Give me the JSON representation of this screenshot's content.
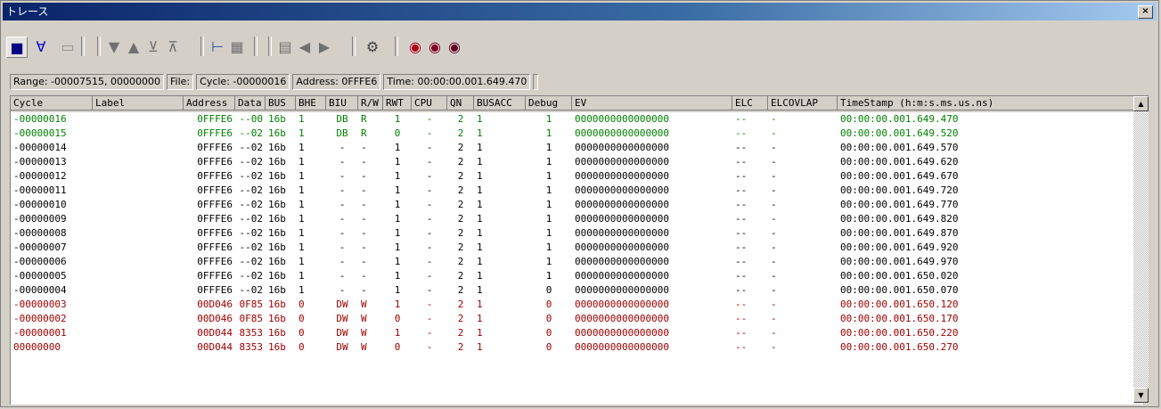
{
  "window": {
    "title": "トレース",
    "close_label": "×"
  },
  "toolbar": {
    "buttons": [
      {
        "name": "trace-on-icon",
        "glyph": "■",
        "color": "#000080"
      },
      {
        "name": "filter-icon",
        "glyph": "∀",
        "color": "#0000cc"
      },
      {
        "name": "copy-icon",
        "glyph": "▭",
        "color": "#909090"
      },
      {
        "name": "scroll-down-icon",
        "glyph": "▼",
        "color": "#707070"
      },
      {
        "name": "scroll-up-icon",
        "glyph": "▲",
        "color": "#707070"
      },
      {
        "name": "jump-end-icon",
        "glyph": "⊻",
        "color": "#707070"
      },
      {
        "name": "jump-start-icon",
        "glyph": "⊼",
        "color": "#707070"
      },
      {
        "name": "tree-icon",
        "glyph": "⊢",
        "color": "#3050a0"
      },
      {
        "name": "columns-icon",
        "glyph": "▦",
        "color": "#707070"
      },
      {
        "name": "list-icon",
        "glyph": "▤",
        "color": "#707070"
      },
      {
        "name": "prev-icon",
        "glyph": "◀",
        "color": "#707070"
      },
      {
        "name": "next-icon",
        "glyph": "▶",
        "color": "#707070"
      },
      {
        "name": "settings-icon",
        "glyph": "⚙",
        "color": "#404040"
      },
      {
        "name": "search-icon",
        "glyph": "◉",
        "color": "#b00020"
      },
      {
        "name": "search-prev-icon",
        "glyph": "◉",
        "color": "#800020"
      },
      {
        "name": "search-next-icon",
        "glyph": "◉",
        "color": "#600020"
      }
    ]
  },
  "status": {
    "range": "Range: -00007515,  00000000",
    "file": "File:",
    "cycle": "Cycle: -00000016",
    "address": "Address: 0FFFE6",
    "time": "Time: 00:00:00.001.649.470"
  },
  "columns": [
    "Cycle",
    "Label",
    "Address",
    "Data",
    "BUS",
    "BHE",
    "BIU",
    "R/W",
    "RWT",
    "CPU",
    "QN",
    "BUSACC",
    "Debug",
    "EV",
    "ELC",
    "ELCOVLAP",
    "TimeStamp (h:m:s.ms.us.ns)"
  ],
  "colors": {
    "green": "#008000",
    "black": "#000000",
    "red": "#a00000"
  },
  "rows": [
    {
      "color": "green",
      "cells": [
        "-00000016",
        "",
        "0FFFE6",
        "--00",
        "16b",
        "1",
        "DB",
        "R",
        "1",
        "-",
        "2",
        "1",
        "1",
        "0000000000000000",
        "--",
        "-",
        "00:00:00.001.649.470"
      ]
    },
    {
      "color": "green",
      "cells": [
        "-00000015",
        "",
        "0FFFE6",
        "--02",
        "16b",
        "1",
        "DB",
        "R",
        "0",
        "-",
        "2",
        "1",
        "1",
        "0000000000000000",
        "--",
        "-",
        "00:00:00.001.649.520"
      ]
    },
    {
      "color": "black",
      "cells": [
        "-00000014",
        "",
        "0FFFE6",
        "--02",
        "16b",
        "1",
        "-",
        "-",
        "1",
        "-",
        "2",
        "1",
        "1",
        "0000000000000000",
        "--",
        "-",
        "00:00:00.001.649.570"
      ]
    },
    {
      "color": "black",
      "cells": [
        "-00000013",
        "",
        "0FFFE6",
        "--02",
        "16b",
        "1",
        "-",
        "-",
        "1",
        "-",
        "2",
        "1",
        "1",
        "0000000000000000",
        "--",
        "-",
        "00:00:00.001.649.620"
      ]
    },
    {
      "color": "black",
      "cells": [
        "-00000012",
        "",
        "0FFFE6",
        "--02",
        "16b",
        "1",
        "-",
        "-",
        "1",
        "-",
        "2",
        "1",
        "1",
        "0000000000000000",
        "--",
        "-",
        "00:00:00.001.649.670"
      ]
    },
    {
      "color": "black",
      "cells": [
        "-00000011",
        "",
        "0FFFE6",
        "--02",
        "16b",
        "1",
        "-",
        "-",
        "1",
        "-",
        "2",
        "1",
        "1",
        "0000000000000000",
        "--",
        "-",
        "00:00:00.001.649.720"
      ]
    },
    {
      "color": "black",
      "cells": [
        "-00000010",
        "",
        "0FFFE6",
        "--02",
        "16b",
        "1",
        "-",
        "-",
        "1",
        "-",
        "2",
        "1",
        "1",
        "0000000000000000",
        "--",
        "-",
        "00:00:00.001.649.770"
      ]
    },
    {
      "color": "black",
      "cells": [
        "-00000009",
        "",
        "0FFFE6",
        "--02",
        "16b",
        "1",
        "-",
        "-",
        "1",
        "-",
        "2",
        "1",
        "1",
        "0000000000000000",
        "--",
        "-",
        "00:00:00.001.649.820"
      ]
    },
    {
      "color": "black",
      "cells": [
        "-00000008",
        "",
        "0FFFE6",
        "--02",
        "16b",
        "1",
        "-",
        "-",
        "1",
        "-",
        "2",
        "1",
        "1",
        "0000000000000000",
        "--",
        "-",
        "00:00:00.001.649.870"
      ]
    },
    {
      "color": "black",
      "cells": [
        "-00000007",
        "",
        "0FFFE6",
        "--02",
        "16b",
        "1",
        "-",
        "-",
        "1",
        "-",
        "2",
        "1",
        "1",
        "0000000000000000",
        "--",
        "-",
        "00:00:00.001.649.920"
      ]
    },
    {
      "color": "black",
      "cells": [
        "-00000006",
        "",
        "0FFFE6",
        "--02",
        "16b",
        "1",
        "-",
        "-",
        "1",
        "-",
        "2",
        "1",
        "1",
        "0000000000000000",
        "--",
        "-",
        "00:00:00.001.649.970"
      ]
    },
    {
      "color": "black",
      "cells": [
        "-00000005",
        "",
        "0FFFE6",
        "--02",
        "16b",
        "1",
        "-",
        "-",
        "1",
        "-",
        "2",
        "1",
        "1",
        "0000000000000000",
        "--",
        "-",
        "00:00:00.001.650.020"
      ]
    },
    {
      "color": "black",
      "cells": [
        "-00000004",
        "",
        "0FFFE6",
        "--02",
        "16b",
        "1",
        "-",
        "-",
        "1",
        "-",
        "2",
        "1",
        "0",
        "0000000000000000",
        "--",
        "-",
        "00:00:00.001.650.070"
      ]
    },
    {
      "color": "red",
      "cells": [
        "-00000003",
        "",
        "00D046",
        "0F85",
        "16b",
        "0",
        "DW",
        "W",
        "1",
        "-",
        "2",
        "1",
        "0",
        "0000000000000000",
        "--",
        "-",
        "00:00:00.001.650.120"
      ]
    },
    {
      "color": "red",
      "cells": [
        "-00000002",
        "",
        "00D046",
        "0F85",
        "16b",
        "0",
        "DW",
        "W",
        "0",
        "-",
        "2",
        "1",
        "0",
        "0000000000000000",
        "--",
        "-",
        "00:00:00.001.650.170"
      ]
    },
    {
      "color": "red",
      "cells": [
        "-00000001",
        "",
        "00D044",
        "8353",
        "16b",
        "0",
        "DW",
        "W",
        "1",
        "-",
        "2",
        "1",
        "0",
        "0000000000000000",
        "--",
        "-",
        "00:00:00.001.650.220"
      ]
    },
    {
      "color": "red",
      "cells": [
        "00000000",
        "",
        "00D044",
        "8353",
        "16b",
        "0",
        "DW",
        "W",
        "0",
        "-",
        "2",
        "1",
        "0",
        "0000000000000000",
        "--",
        "-",
        "00:00:00.001.650.270"
      ]
    }
  ],
  "scrollbar": {
    "up_glyph": "▲",
    "down_glyph": "▼"
  }
}
